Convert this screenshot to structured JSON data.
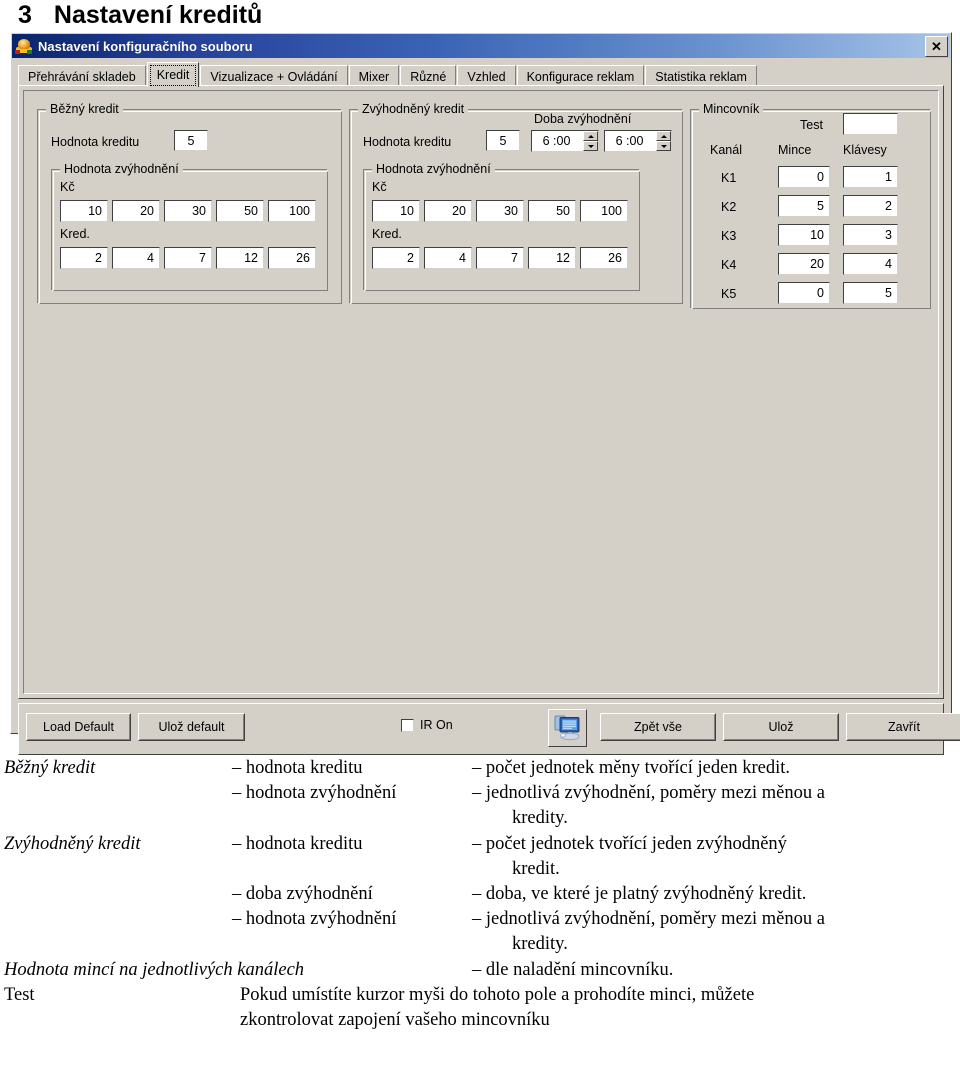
{
  "document": {
    "section_number": "3",
    "section_title": "Nastavení kreditů"
  },
  "window": {
    "title": "Nastavení konfiguračního souboru",
    "title_icon": "app-icon",
    "close_label": "✕"
  },
  "tabs": [
    {
      "label": "Přehrávání skladeb",
      "selected": false
    },
    {
      "label": "Kredit",
      "selected": true
    },
    {
      "label": "Vizualizace + Ovládání",
      "selected": false
    },
    {
      "label": "Mixer",
      "selected": false
    },
    {
      "label": "Různé",
      "selected": false
    },
    {
      "label": "Vzhled",
      "selected": false
    },
    {
      "label": "Konfigurace reklam",
      "selected": false
    },
    {
      "label": "Statistika reklam",
      "selected": false
    }
  ],
  "groups": {
    "bezny_kredit": {
      "title": "Běžný kredit",
      "hodnota_kreditu_label": "Hodnota kreditu",
      "hodnota_kreditu_value": "5",
      "inner": {
        "title": "Hodnota zvýhodnění",
        "kc_label": "Kč",
        "kc_values": [
          "10",
          "20",
          "30",
          "50",
          "100"
        ],
        "kred_label": "Kred.",
        "kred_values": [
          "2",
          "4",
          "7",
          "12",
          "26"
        ]
      }
    },
    "zvyhodneny_kredit": {
      "title": "Zvýhodněný kredit",
      "hodnota_kreditu_label": "Hodnota kreditu",
      "hodnota_kreditu_value": "5",
      "doba_label": "Doba zvýhodnění",
      "doba_from": "6 :00",
      "doba_to": "6 :00",
      "inner": {
        "title": "Hodnota zvýhodnění",
        "kc_label": "Kč",
        "kc_values": [
          "10",
          "20",
          "30",
          "50",
          "100"
        ],
        "kred_label": "Kred.",
        "kred_values": [
          "2",
          "4",
          "7",
          "12",
          "26"
        ]
      }
    },
    "mincovnik": {
      "title": "Mincovník",
      "test_label": "Test",
      "test_value": "",
      "col_kanal": "Kanál",
      "col_mince": "Mince",
      "col_klavesy": "Klávesy",
      "rows": [
        {
          "kanal": "K1",
          "mince": "0",
          "klavesy": "1"
        },
        {
          "kanal": "K2",
          "mince": "5",
          "klavesy": "2"
        },
        {
          "kanal": "K3",
          "mince": "10",
          "klavesy": "3"
        },
        {
          "kanal": "K4",
          "mince": "20",
          "klavesy": "4"
        },
        {
          "kanal": "K5",
          "mince": "0",
          "klavesy": "5"
        }
      ]
    }
  },
  "bottom_bar": {
    "load_default": "Load Default",
    "uloz_default": "Ulož default",
    "ir_on": "IR On",
    "ir_on_checked": false,
    "monitor_icon": "monitor-icon",
    "zpet_vse": "Zpět vše",
    "uloz": "Ulož",
    "zavrit": "Zavřít"
  },
  "documentation": [
    {
      "term": "Běžný kredit",
      "term_italic": true,
      "param": "– hodnota kreditu",
      "desc": "– počet jednotek měny tvořící jeden kredit."
    },
    {
      "term": "",
      "term_italic": false,
      "param": "– hodnota zvýhodnění",
      "desc": "– jednotlivá zvýhodnění, poměry mezi měnou a"
    },
    {
      "term": "",
      "term_italic": false,
      "param": "",
      "desc": "kredity.",
      "indent_desc": true
    },
    {
      "term": "Zvýhodněný kredit",
      "term_italic": true,
      "param": "– hodnota kreditu",
      "desc": "– počet jednotek tvořící jeden zvýhodněný"
    },
    {
      "term": "",
      "term_italic": false,
      "param": "",
      "desc": "kredit.",
      "indent_desc": true
    },
    {
      "term": "",
      "term_italic": false,
      "param": "– doba zvýhodnění",
      "desc": "– doba, ve které je platný zvýhodněný kredit."
    },
    {
      "term": "",
      "term_italic": false,
      "param": "– hodnota zvýhodnění",
      "desc": "– jednotlivá zvýhodnění, poměry mezi měnou a"
    },
    {
      "term": "",
      "term_italic": false,
      "param": "",
      "desc": "kredity.",
      "indent_desc": true
    },
    {
      "term": "Hodnota mincí na jednotlivých kanálech",
      "term_italic": true,
      "term_wide": true,
      "param": "",
      "desc": "– dle naladění mincovníku."
    },
    {
      "term": "Test",
      "term_italic": false,
      "param": "",
      "desc": "Pokud umístíte kurzor myši do tohoto pole a prohodíte minci, můžete",
      "desc_from_c2": true
    },
    {
      "term": "",
      "term_italic": false,
      "param": "",
      "desc": "zkontrolovat zapojení vašeho mincovníku",
      "indent_desc": true
    }
  ]
}
